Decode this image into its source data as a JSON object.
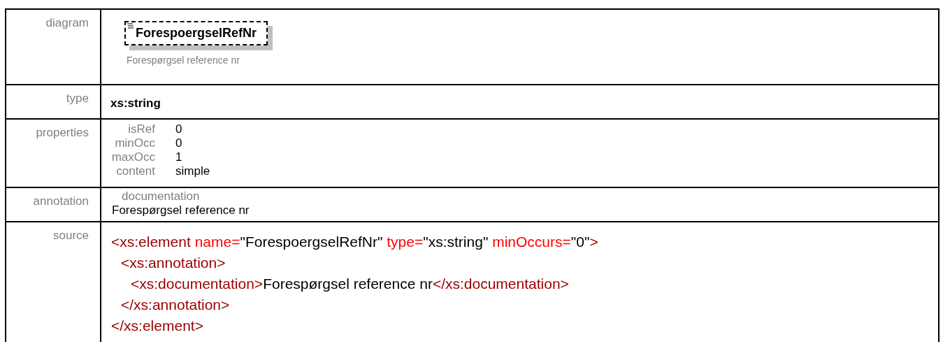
{
  "diagram": {
    "label": "diagram",
    "element_name": "ForespoergselRefNr",
    "element_doc": "Forespørgsel reference nr"
  },
  "type": {
    "label": "type",
    "value": "xs:string"
  },
  "properties": {
    "label": "properties",
    "items": [
      {
        "name": "isRef",
        "value": "0"
      },
      {
        "name": "minOcc",
        "value": "0"
      },
      {
        "name": "maxOcc",
        "value": "1"
      },
      {
        "name": "content",
        "value": "simple"
      }
    ]
  },
  "annotation": {
    "label": "annotation",
    "heading": "documentation",
    "text": "Forespørgsel reference nr"
  },
  "source": {
    "label": "source",
    "lines": [
      {
        "tokens": [
          {
            "kind": "tag",
            "text": "<xs:element"
          },
          {
            "kind": "attr",
            "text": " name="
          },
          {
            "kind": "value",
            "text": "\"ForespoergselRefNr\""
          },
          {
            "kind": "attr",
            "text": " type="
          },
          {
            "kind": "value",
            "text": "\"xs:string\""
          },
          {
            "kind": "attr",
            "text": " minOccurs="
          },
          {
            "kind": "value",
            "text": "\"0\""
          },
          {
            "kind": "tag",
            "text": ">"
          }
        ],
        "children": [
          {
            "tokens": [
              {
                "kind": "tag",
                "text": "<xs:annotation>"
              }
            ],
            "children": [
              {
                "tokens": [
                  {
                    "kind": "tag",
                    "text": "<xs:documentation>"
                  },
                  {
                    "kind": "text",
                    "text": "Forespørgsel reference nr"
                  },
                  {
                    "kind": "tag",
                    "text": "</xs:documentation>"
                  }
                ]
              }
            ]
          },
          {
            "tokens": [
              {
                "kind": "tag",
                "text": "</xs:annotation>"
              }
            ]
          }
        ]
      },
      {
        "tokens": [
          {
            "kind": "tag",
            "text": "</xs:element>"
          }
        ]
      }
    ]
  }
}
